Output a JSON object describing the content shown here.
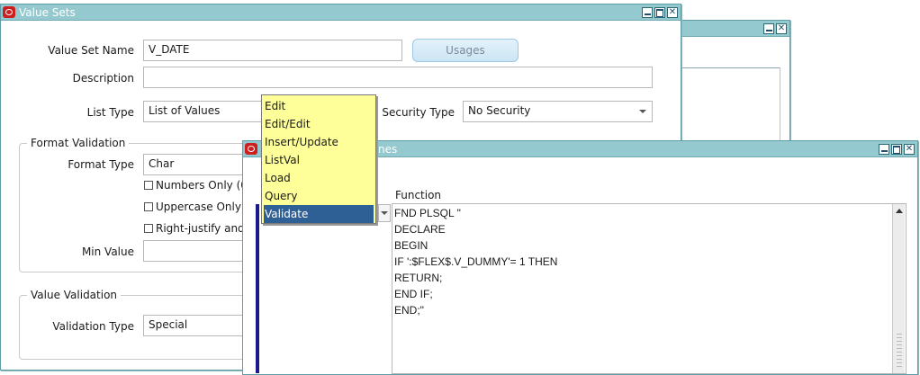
{
  "colors": {
    "titlebar": "#94c9cf",
    "menu_bg": "#ffff99",
    "menu_selected": "#2e5f95",
    "oracle_icon": "#cc2020",
    "scroll_indicator": "#1a1a8c"
  },
  "value_sets_window": {
    "title": "Value Sets",
    "value_set_name_label": "Value Set Name",
    "value_set_name_value": "V_DATE",
    "usages_button": "Usages",
    "description_label": "Description",
    "description_value": "",
    "list_type_label": "List Type",
    "list_type_value": "List of Values",
    "security_type_label": "Security Type",
    "security_type_value": "No Security",
    "format_validation": {
      "legend": "Format Validation",
      "format_type_label": "Format Type",
      "format_type_value": "Char",
      "numbers_only_label": "Numbers Only (0",
      "uppercase_only_label": "Uppercase Only",
      "right_justify_label": "Right-justify and",
      "min_value_label": "Min Value",
      "min_value_value": ""
    },
    "value_validation": {
      "legend": "Value Validation",
      "validation_type_label": "Validation Type",
      "validation_type_value": "Special"
    }
  },
  "routines_window": {
    "title_fragment": "nes",
    "function_label": "Function",
    "function_code": [
      "FND PLSQL \"",
      "DECLARE",
      "BEGIN",
      "IF ':$FLEX$.V_DUMMY'= 1 THEN",
      "RETURN;",
      "END IF;",
      "END;\""
    ]
  },
  "event_menu": {
    "items": [
      "Edit",
      "Edit/Edit",
      "Insert/Update",
      "ListVal",
      "Load",
      "Query",
      "Validate"
    ],
    "selected": "Validate"
  },
  "icons": {
    "window_controls": [
      "minimize-icon",
      "maximize-icon",
      "close-icon"
    ],
    "app_icon": "oracle-icon"
  }
}
